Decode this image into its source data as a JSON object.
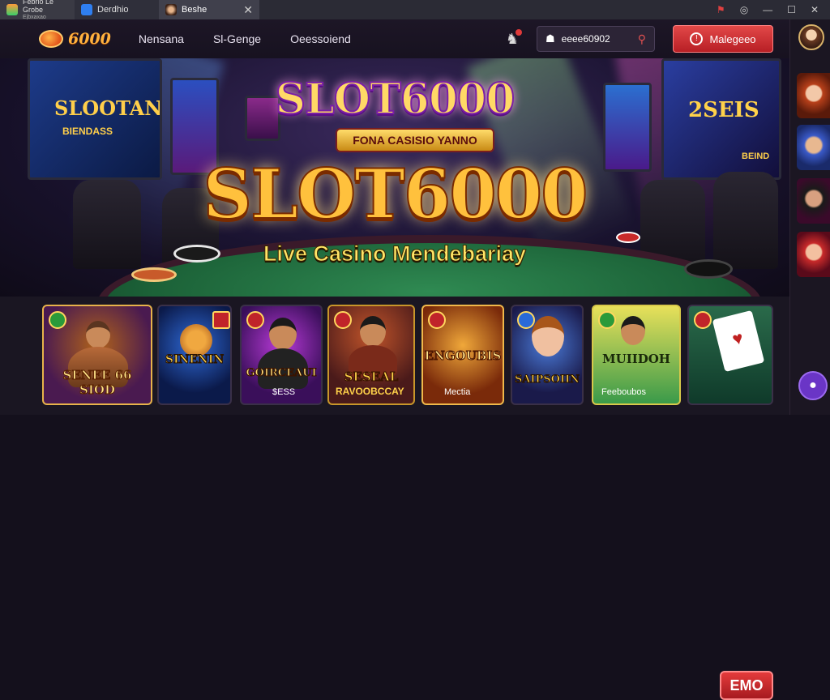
{
  "browser": {
    "tabs": [
      {
        "label": "Febrio Lé Grobe",
        "sublabel": "Ejbxaxao"
      },
      {
        "label": "Derdhio"
      },
      {
        "label": "Beshe"
      }
    ],
    "close_glyph": "✕",
    "controls": [
      "⚑",
      "◎",
      "—",
      "☐",
      "✕"
    ]
  },
  "header": {
    "logo_text": "6000",
    "nav": [
      "Nensana",
      "Sl-Genge",
      "Oeessoiend"
    ],
    "search_value": "eeee60902",
    "cta_label": "Malegeeo"
  },
  "hero": {
    "title_small": "SLOT6000",
    "ribbon": "FONA CASISIO YANNO",
    "title_big": "SLOT6000",
    "subtitle": "Live Casino Mendebariay",
    "left_screen_text": [
      "SLOOTANG",
      "BIENDASS"
    ],
    "right_screen_text": [
      "2SEIS",
      "BEIND"
    ]
  },
  "games": [
    {
      "title": "SENEE 66 SIOD"
    },
    {
      "title": "SINENIN"
    },
    {
      "title": "GOIRCEAUI",
      "sub": "$ESS"
    },
    {
      "title": "SESEAL",
      "sub": "RAVOOBCCAY"
    },
    {
      "title": "ENGOUBIS",
      "sub": "Mectia"
    },
    {
      "title": "SAIPSOIIN"
    },
    {
      "title": "MUIIDOH",
      "sub": "Feeboubos"
    },
    {
      "title": "EMO"
    }
  ],
  "colors": {
    "accent": "#e24848",
    "gold": "#ffc13d",
    "felt": "#1c6238",
    "purple": "#6a35c6"
  },
  "icons": [
    "bell-icon",
    "car-icon",
    "search-icon",
    "alert-icon",
    "chat-icon",
    "flag-icon",
    "target-icon",
    "minimize-icon",
    "maximize-icon",
    "close-icon"
  ]
}
